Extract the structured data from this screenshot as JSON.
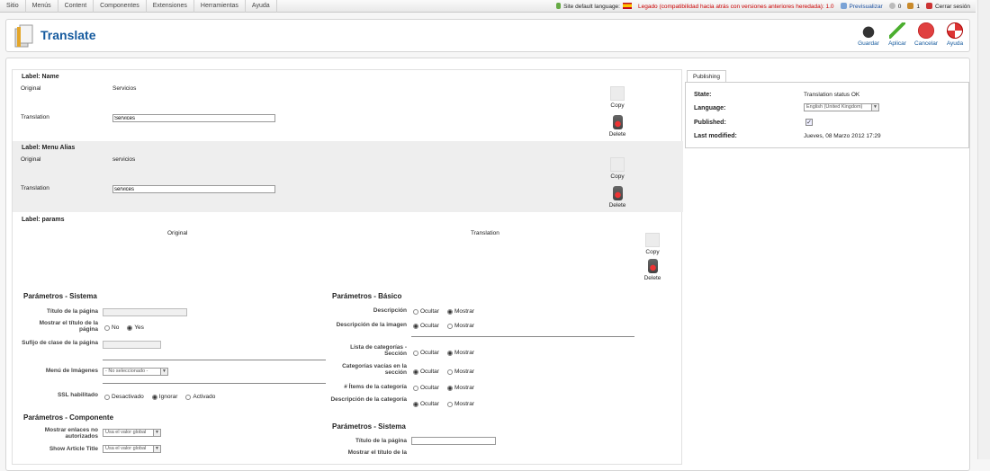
{
  "menu": [
    "Sitio",
    "Menús",
    "Content",
    "Componentes",
    "Extensiones",
    "Herramientas",
    "Ayuda"
  ],
  "status": {
    "site_lang": "Site default language:",
    "legacy": "Legado (compatibilidad hacia atrás con versiones anteriores heredada): 1.0",
    "preview": "Previsualizar",
    "msgs": "0",
    "users": "1",
    "logout": "Cerrar sesión"
  },
  "title": "Translate",
  "toolbar": {
    "save": "Guardar",
    "apply": "Aplicar",
    "cancel": "Cancelar",
    "help": "Ayuda"
  },
  "fields": {
    "name": {
      "label": "Label: Name",
      "original_label": "Original",
      "original": "Servicios",
      "translation_label": "Translation",
      "translation": "Services"
    },
    "alias": {
      "label": "Label: Menu Alias",
      "original_label": "Original",
      "original": "servicios",
      "translation_label": "Translation",
      "translation": "services"
    },
    "params": {
      "label": "Label: params",
      "original_col": "Original",
      "translation_col": "Translation"
    }
  },
  "actions": {
    "copy": "Copy",
    "delete": "Delete"
  },
  "left_params": {
    "system_title": "Parámetros - Sistema",
    "page_title": "Título de la página",
    "show_page_title": "Mostrar el título de la página",
    "no": "No",
    "yes": "Yes",
    "page_class": "Sufijo de clase de la página",
    "menu_image": "Menú de Imágenes",
    "menu_image_value": "- No seleccionado -",
    "ssl": "SSL habilitado",
    "ssl_off": "Desactivado",
    "ssl_ignore": "Ignorar",
    "ssl_on": "Activado",
    "component_title": "Parámetros - Componente",
    "unauth_links": "Mostrar enlaces no autorizados",
    "global_value": "Usa el valor global",
    "show_article_title": "Show Article Title"
  },
  "right_params": {
    "basic_title": "Parámetros - Básico",
    "description": "Descripción",
    "desc_image": "Descripción de la imagen",
    "cat_list": "Lista de categorías - Sección",
    "empty_cats": "Categorías vacías en la sección",
    "items_count": "# Ítems de la categoría",
    "cat_desc": "Descripción de la categoría",
    "hide": "Ocultar",
    "show": "Mostrar",
    "system_title": "Parámetros - Sistema",
    "page_title": "Título de la página",
    "show_page_title": "Mostrar el título de la"
  },
  "publishing": {
    "tab": "Publishing",
    "state_label": "State:",
    "state": "Translation status OK",
    "lang_label": "Language:",
    "lang": "English (United Kingdom)",
    "published_label": "Published:",
    "modified_label": "Last modified:",
    "modified": "Jueves, 08 Marzo 2012 17:29"
  }
}
